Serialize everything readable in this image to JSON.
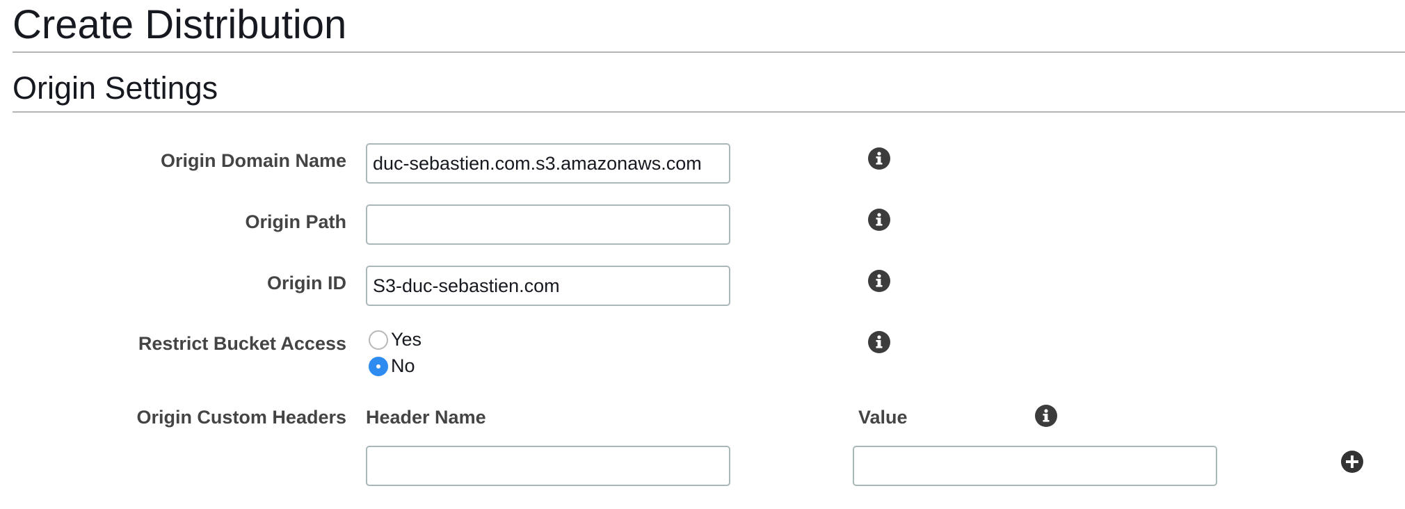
{
  "page": {
    "title": "Create Distribution"
  },
  "section": {
    "title": "Origin Settings"
  },
  "fields": {
    "origin_domain_name": {
      "label": "Origin Domain Name",
      "value": "duc-sebastien.com.s3.amazonaws.com"
    },
    "origin_path": {
      "label": "Origin Path",
      "value": ""
    },
    "origin_id": {
      "label": "Origin ID",
      "value": "S3-duc-sebastien.com"
    },
    "restrict_bucket_access": {
      "label": "Restrict Bucket Access",
      "options": [
        "Yes",
        "No"
      ],
      "selected": "No"
    },
    "origin_custom_headers": {
      "label": "Origin Custom Headers",
      "header_name_label": "Header Name",
      "value_label": "Value",
      "header_name_value": "",
      "value_value": ""
    }
  },
  "icons": {
    "info": "info-circle-icon",
    "add": "plus-circle-icon"
  },
  "colors": {
    "radio_selected": "#2e8cf0",
    "icon": "#3c3c3c",
    "label": "#444444"
  }
}
